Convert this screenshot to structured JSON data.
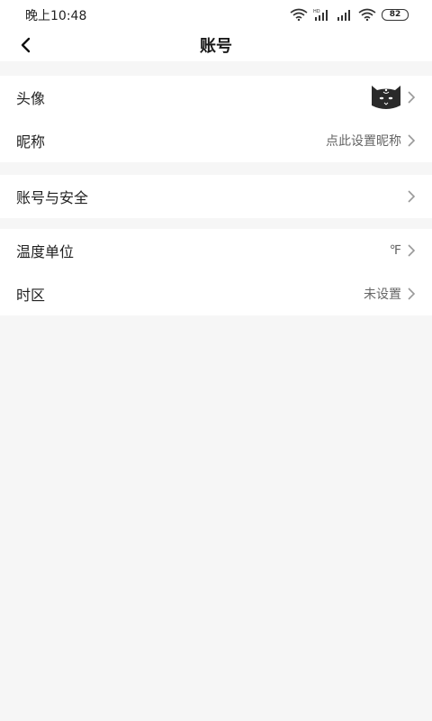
{
  "status_bar": {
    "time": "晚上10:48",
    "battery": "82"
  },
  "header": {
    "title": "账号",
    "back_icon": "chevron-left-icon"
  },
  "groups": [
    {
      "items": [
        {
          "label": "头像",
          "value": "",
          "trailing": "avatar-image"
        },
        {
          "label": "昵称",
          "value": "点此设置昵称"
        }
      ]
    },
    {
      "items": [
        {
          "label": "账号与安全",
          "value": ""
        }
      ]
    },
    {
      "items": [
        {
          "label": "温度单位",
          "value": "℉"
        },
        {
          "label": "时区",
          "value": "未设置"
        }
      ]
    }
  ],
  "colors": {
    "background": "#f6f6f6",
    "card": "#ffffff",
    "text": "#222222",
    "secondary_text": "#666666",
    "chevron": "#999999"
  }
}
